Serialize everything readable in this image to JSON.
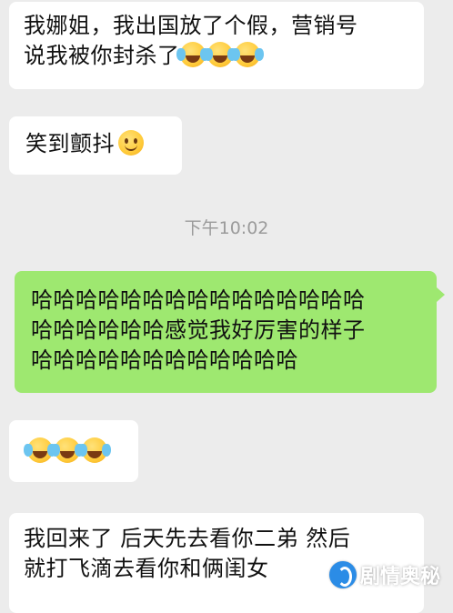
{
  "messages": [
    {
      "lines": [
        "我娜姐，我出国放了个假，营销号",
        "说我被你封杀了"
      ]
    },
    {
      "lines": [
        "笑到颤抖"
      ]
    },
    {
      "lines": [
        "哈哈哈哈哈哈哈哈哈哈哈哈哈哈哈",
        "哈哈哈哈哈哈感觉我好厉害的样子",
        "哈哈哈哈哈哈哈哈哈哈哈哈"
      ]
    },
    {
      "lines": [
        "我回来了 后天先去看你二弟 然后",
        "就打飞滴去看你和俩闺女"
      ]
    }
  ],
  "timestamp": "下午10:02",
  "emojis": {
    "laugh_cry": "laugh-crying-emoji",
    "smile": "smile-emoji"
  },
  "watermark": {
    "text": "剧情奥秘"
  },
  "colors": {
    "background": "#ececec",
    "incoming_bubble": "#ffffff",
    "outgoing_bubble": "#9ee870",
    "timestamp": "#9b9b9b"
  }
}
